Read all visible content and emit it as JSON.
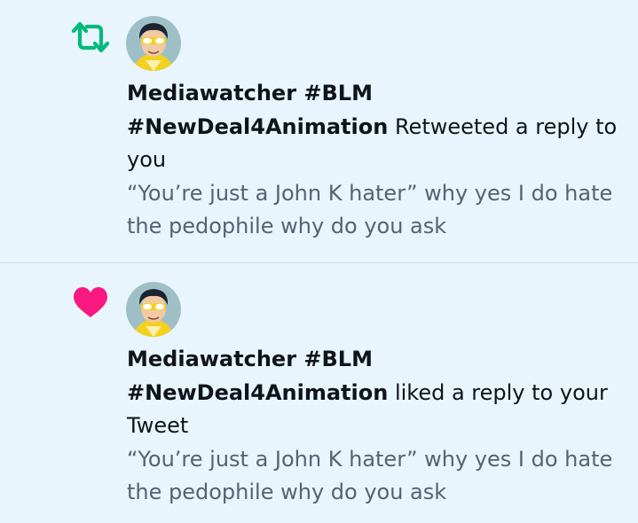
{
  "notifications": [
    {
      "type_icon": "retweet-icon",
      "user_name": "Mediawatcher #BLM #NewDeal4Animation",
      "action_text": " Retweeted a reply to you",
      "tweet_text": "“You’re just a John K hater” why yes I do hate the pedophile why do you ask"
    },
    {
      "type_icon": "heart-icon",
      "user_name": "Mediawatcher #BLM #NewDeal4Animation",
      "action_text": " liked a reply to your Tweet",
      "tweet_text": "“You’re just a John K hater” why yes I do hate the pedophile why do you ask"
    }
  ],
  "colors": {
    "background": "#e8f5fd",
    "retweet": "#00ba7c",
    "like": "#f91880",
    "primary_text": "#0f1419",
    "secondary_text": "#536471",
    "divider": "#cfd9de"
  }
}
